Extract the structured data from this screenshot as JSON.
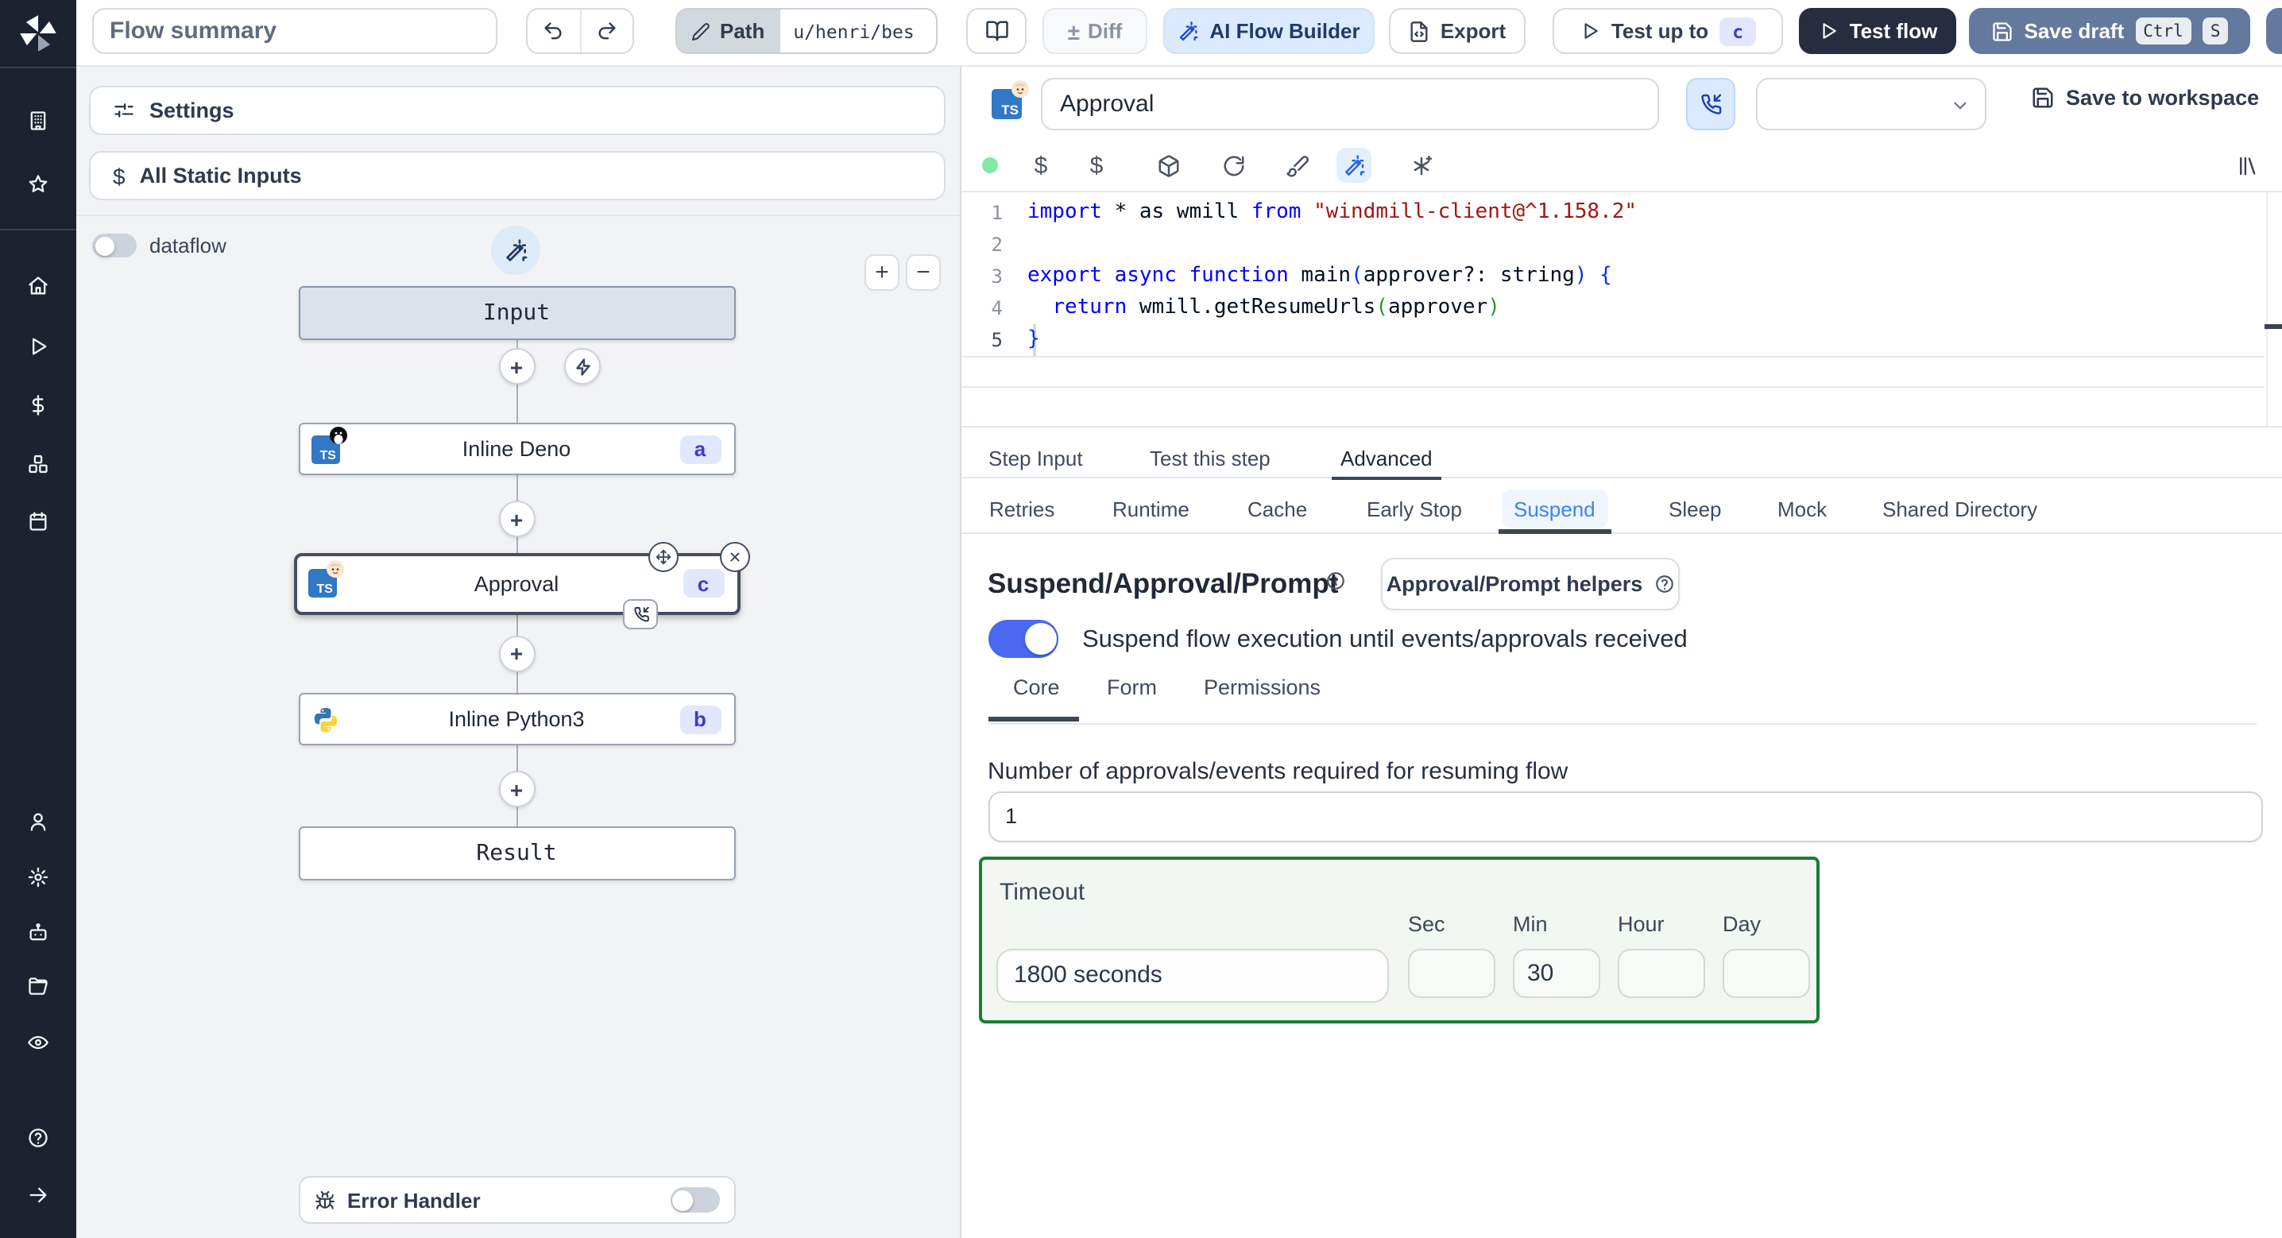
{
  "topbar": {
    "flow_summary_placeholder": "Flow summary",
    "path_label": "Path",
    "path_value": "u/henri/bes",
    "diff_label": "Diff",
    "plusminus": "±",
    "ai_flow_builder_label": "AI Flow Builder",
    "export_label": "Export",
    "test_up_to_label": "Test up to",
    "test_up_to_badge": "c",
    "test_flow_label": "Test flow",
    "save_draft_label": "Save draft",
    "kbd_ctrl": "Ctrl",
    "kbd_s": "S"
  },
  "left_panel": {
    "settings_label": "Settings",
    "static_inputs_label": "All Static Inputs",
    "dataflow_label": "dataflow",
    "zoom_in": "+",
    "zoom_out": "−",
    "error_handler_label": "Error Handler",
    "nodes": {
      "input_label": "Input",
      "deno_label": "Inline Deno",
      "deno_badge": "a",
      "approval_label": "Approval",
      "approval_badge": "c",
      "python_label": "Inline Python3",
      "python_badge": "b",
      "result_label": "Result"
    }
  },
  "module_header": {
    "name_value": "Approval",
    "save_to_workspace_label": "Save to workspace"
  },
  "editor": {
    "line_numbers": [
      "1",
      "2",
      "3",
      "4",
      "5"
    ],
    "lines": [
      [
        [
          "kw",
          "import"
        ],
        [
          "pl",
          " * as wmill "
        ],
        [
          "kw",
          "from"
        ],
        [
          "pl",
          " "
        ],
        [
          "str",
          "\"windmill-client@^1.158.2\""
        ]
      ],
      [],
      [
        [
          "kw",
          "export"
        ],
        [
          "pl",
          " "
        ],
        [
          "kw",
          "async"
        ],
        [
          "pl",
          " "
        ],
        [
          "kw",
          "function"
        ],
        [
          "pl",
          " main"
        ],
        [
          "b1",
          "("
        ],
        [
          "pl",
          "approver?: string"
        ],
        [
          "b1",
          ")"
        ],
        [
          "pl",
          " "
        ],
        [
          "b1",
          "{"
        ]
      ],
      [
        [
          "pl",
          "  "
        ],
        [
          "kw",
          "return"
        ],
        [
          "pl",
          " wmill.getResumeUrls"
        ],
        [
          "b2",
          "("
        ],
        [
          "pl",
          "approver"
        ],
        [
          "b2",
          ")"
        ]
      ],
      [
        [
          "b1",
          "}"
        ]
      ]
    ]
  },
  "tabs": {
    "main": [
      "Step Input",
      "Test this step",
      "Advanced"
    ],
    "advanced": [
      "Retries",
      "Runtime",
      "Cache",
      "Early Stop",
      "Suspend",
      "Sleep",
      "Mock",
      "Shared Directory"
    ]
  },
  "suspend": {
    "heading": "Suspend/Approval/Prompt",
    "helpers_button": "Approval/Prompt helpers",
    "toggle_label": "Suspend flow execution until events/approvals received",
    "core_tabs": [
      "Core",
      "Form",
      "Permissions"
    ],
    "approvals_label": "Number of approvals/events required for resuming flow",
    "approvals_value": "1",
    "timeout_label": "Timeout",
    "timeout_value": "1800 seconds",
    "unit_sec": "Sec",
    "unit_min": "Min",
    "unit_hour": "Hour",
    "unit_day": "Day",
    "min_value": "30"
  },
  "colors": {
    "accent_blue": "#4a69f0",
    "suspend_tab_blue": "#3b82f6",
    "timeout_border_green": "#1b7d39",
    "save_draft_slate": "#64799e",
    "test_flow_dark": "#262d3e",
    "sidebar_dark": "#1d2230"
  }
}
